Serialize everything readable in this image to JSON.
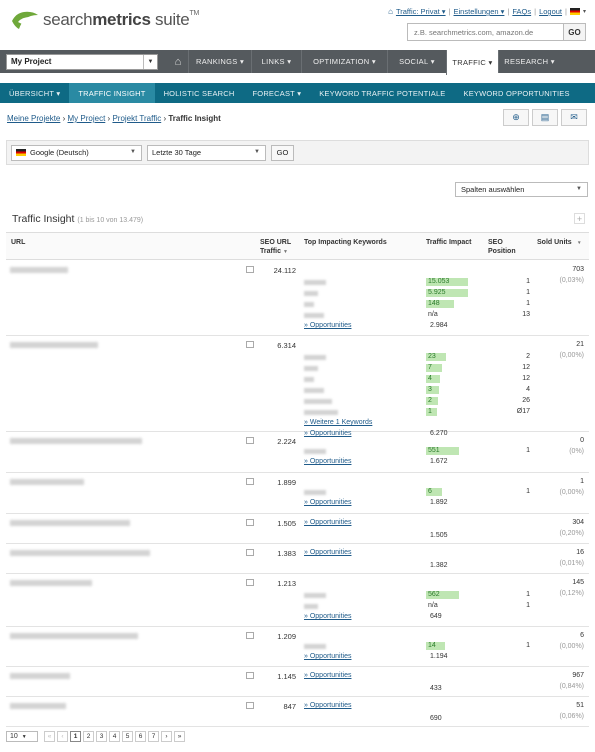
{
  "header": {
    "logo_text_light": "search",
    "logo_text_bold": "metrics",
    "logo_text_suffix": " suite",
    "logo_tm": "TM",
    "links": [
      "Traffic: Privat ▾",
      "Einstellungen ▾",
      "FAQs",
      "Logout",
      "▾"
    ],
    "search_placeholder": "z.B. searchmetrics.com, amazon.de",
    "search_go": "GO"
  },
  "nav": {
    "project": "My Project",
    "items": [
      "RANKINGS",
      "LINKS",
      "OPTIMIZATION",
      "SOCIAL",
      "TRAFFIC",
      "RESEARCH"
    ],
    "active": "TRAFFIC"
  },
  "subnav": {
    "items": [
      "ÜBERSICHT",
      "TRAFFIC INSIGHT",
      "HOLISTIC SEARCH",
      "FORECAST",
      "KEYWORD TRAFFIC POTENTIALE",
      "KEYWORD OPPORTUNITIES"
    ],
    "active": "TRAFFIC INSIGHT"
  },
  "breadcrumb": {
    "links": [
      "Meine Projekte",
      "My Project",
      "Projekt Traffic"
    ],
    "current": "Traffic Insight",
    "sep": "›"
  },
  "filters": {
    "engine": "Google (Deutsch)",
    "period": "Letzte 30 Tage",
    "go": "GO",
    "columns": "Spalten auswählen"
  },
  "table": {
    "title": "Traffic Insight",
    "subtitle": "(1 bis 10 von 13.479)",
    "headers": {
      "url": "URL",
      "seo_traffic": "SEO URL Traffic",
      "keywords": "Top Impacting Keywords",
      "impact": "Traffic Impact",
      "position": "SEO Position",
      "sold": "Sold Units"
    },
    "opportunities_label": "» Opportunities",
    "more_keywords_label": "» Weitere 1 Keywords",
    "rows": [
      {
        "seo": "24.112",
        "impacts": [
          "15.053",
          "5.925",
          "148",
          "n/a"
        ],
        "positions": [
          "1",
          "1",
          "1",
          "13"
        ],
        "total": "2.984",
        "sold": "703",
        "sold_pct": "(0,03%)"
      },
      {
        "seo": "6.314",
        "impacts": [
          "23",
          "7",
          "4",
          "3",
          "2",
          "1"
        ],
        "positions": [
          "2",
          "12",
          "12",
          "4",
          "26",
          "Ø17"
        ],
        "total": "6.270",
        "sold": "21",
        "sold_pct": "(0,00%)"
      },
      {
        "seo": "2.224",
        "impacts": [
          "551"
        ],
        "positions": [
          "1"
        ],
        "total": "1.672",
        "sold": "0",
        "sold_pct": "(0%)"
      },
      {
        "seo": "1.899",
        "impacts": [
          "6"
        ],
        "positions": [
          "1"
        ],
        "total": "1.892",
        "sold": "1",
        "sold_pct": "(0,00%)"
      },
      {
        "seo": "1.505",
        "impacts": [],
        "positions": [],
        "total": "1.505",
        "sold": "304",
        "sold_pct": "(0,20%)"
      },
      {
        "seo": "1.383",
        "impacts": [],
        "positions": [],
        "total": "1.382",
        "sold": "16",
        "sold_pct": "(0,01%)"
      },
      {
        "seo": "1.213",
        "impacts": [
          "562",
          "n/a"
        ],
        "positions": [
          "1",
          "1"
        ],
        "total": "649",
        "sold": "145",
        "sold_pct": "(0,12%)"
      },
      {
        "seo": "1.209",
        "impacts": [
          "14"
        ],
        "positions": [
          "1"
        ],
        "total": "1.194",
        "sold": "6",
        "sold_pct": "(0,00%)"
      },
      {
        "seo": "1.145",
        "impacts": [],
        "positions": [],
        "total": "433",
        "sold": "967",
        "sold_pct": "(0,84%)"
      },
      {
        "seo": "847",
        "impacts": [],
        "positions": [],
        "total": "690",
        "sold": "51",
        "sold_pct": "(0,06%)"
      }
    ]
  },
  "pager": {
    "per_page": "10",
    "pages": [
      "1",
      "2",
      "3",
      "4",
      "5",
      "6",
      "7"
    ],
    "current": "1",
    "first": "«",
    "prev": "‹",
    "next": "›",
    "last": "»"
  },
  "colors": {
    "nav_bg": "#555a5e",
    "subnav_bg": "#0e6a84",
    "link": "#1f5b8a",
    "bar": "#bfe6b3"
  }
}
